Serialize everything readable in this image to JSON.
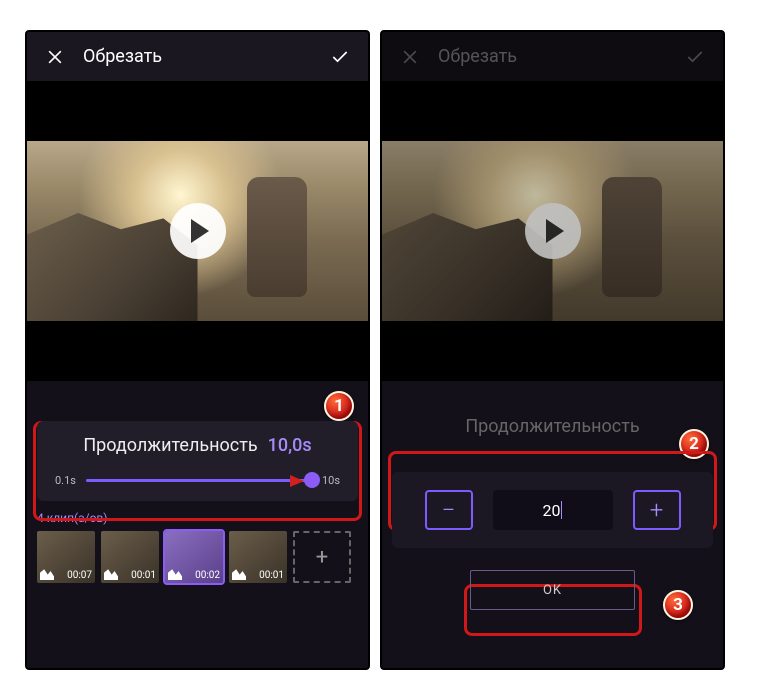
{
  "left": {
    "header_title": "Обрезать",
    "duration_label": "Продолжительность",
    "duration_value": "10,0s",
    "slider_min": "0.1s",
    "slider_max": "10s",
    "clips_count": "4 клип(а/ов)",
    "thumbs": [
      {
        "time": "00:07"
      },
      {
        "time": "00:01"
      },
      {
        "time": "00:02"
      },
      {
        "time": "00:01"
      }
    ]
  },
  "right": {
    "header_title": "Обрезать",
    "duration_label": "Продолжительность",
    "input_value": "20",
    "ok_label": "OK"
  },
  "badges": {
    "one": "1",
    "two": "2",
    "three": "3"
  }
}
